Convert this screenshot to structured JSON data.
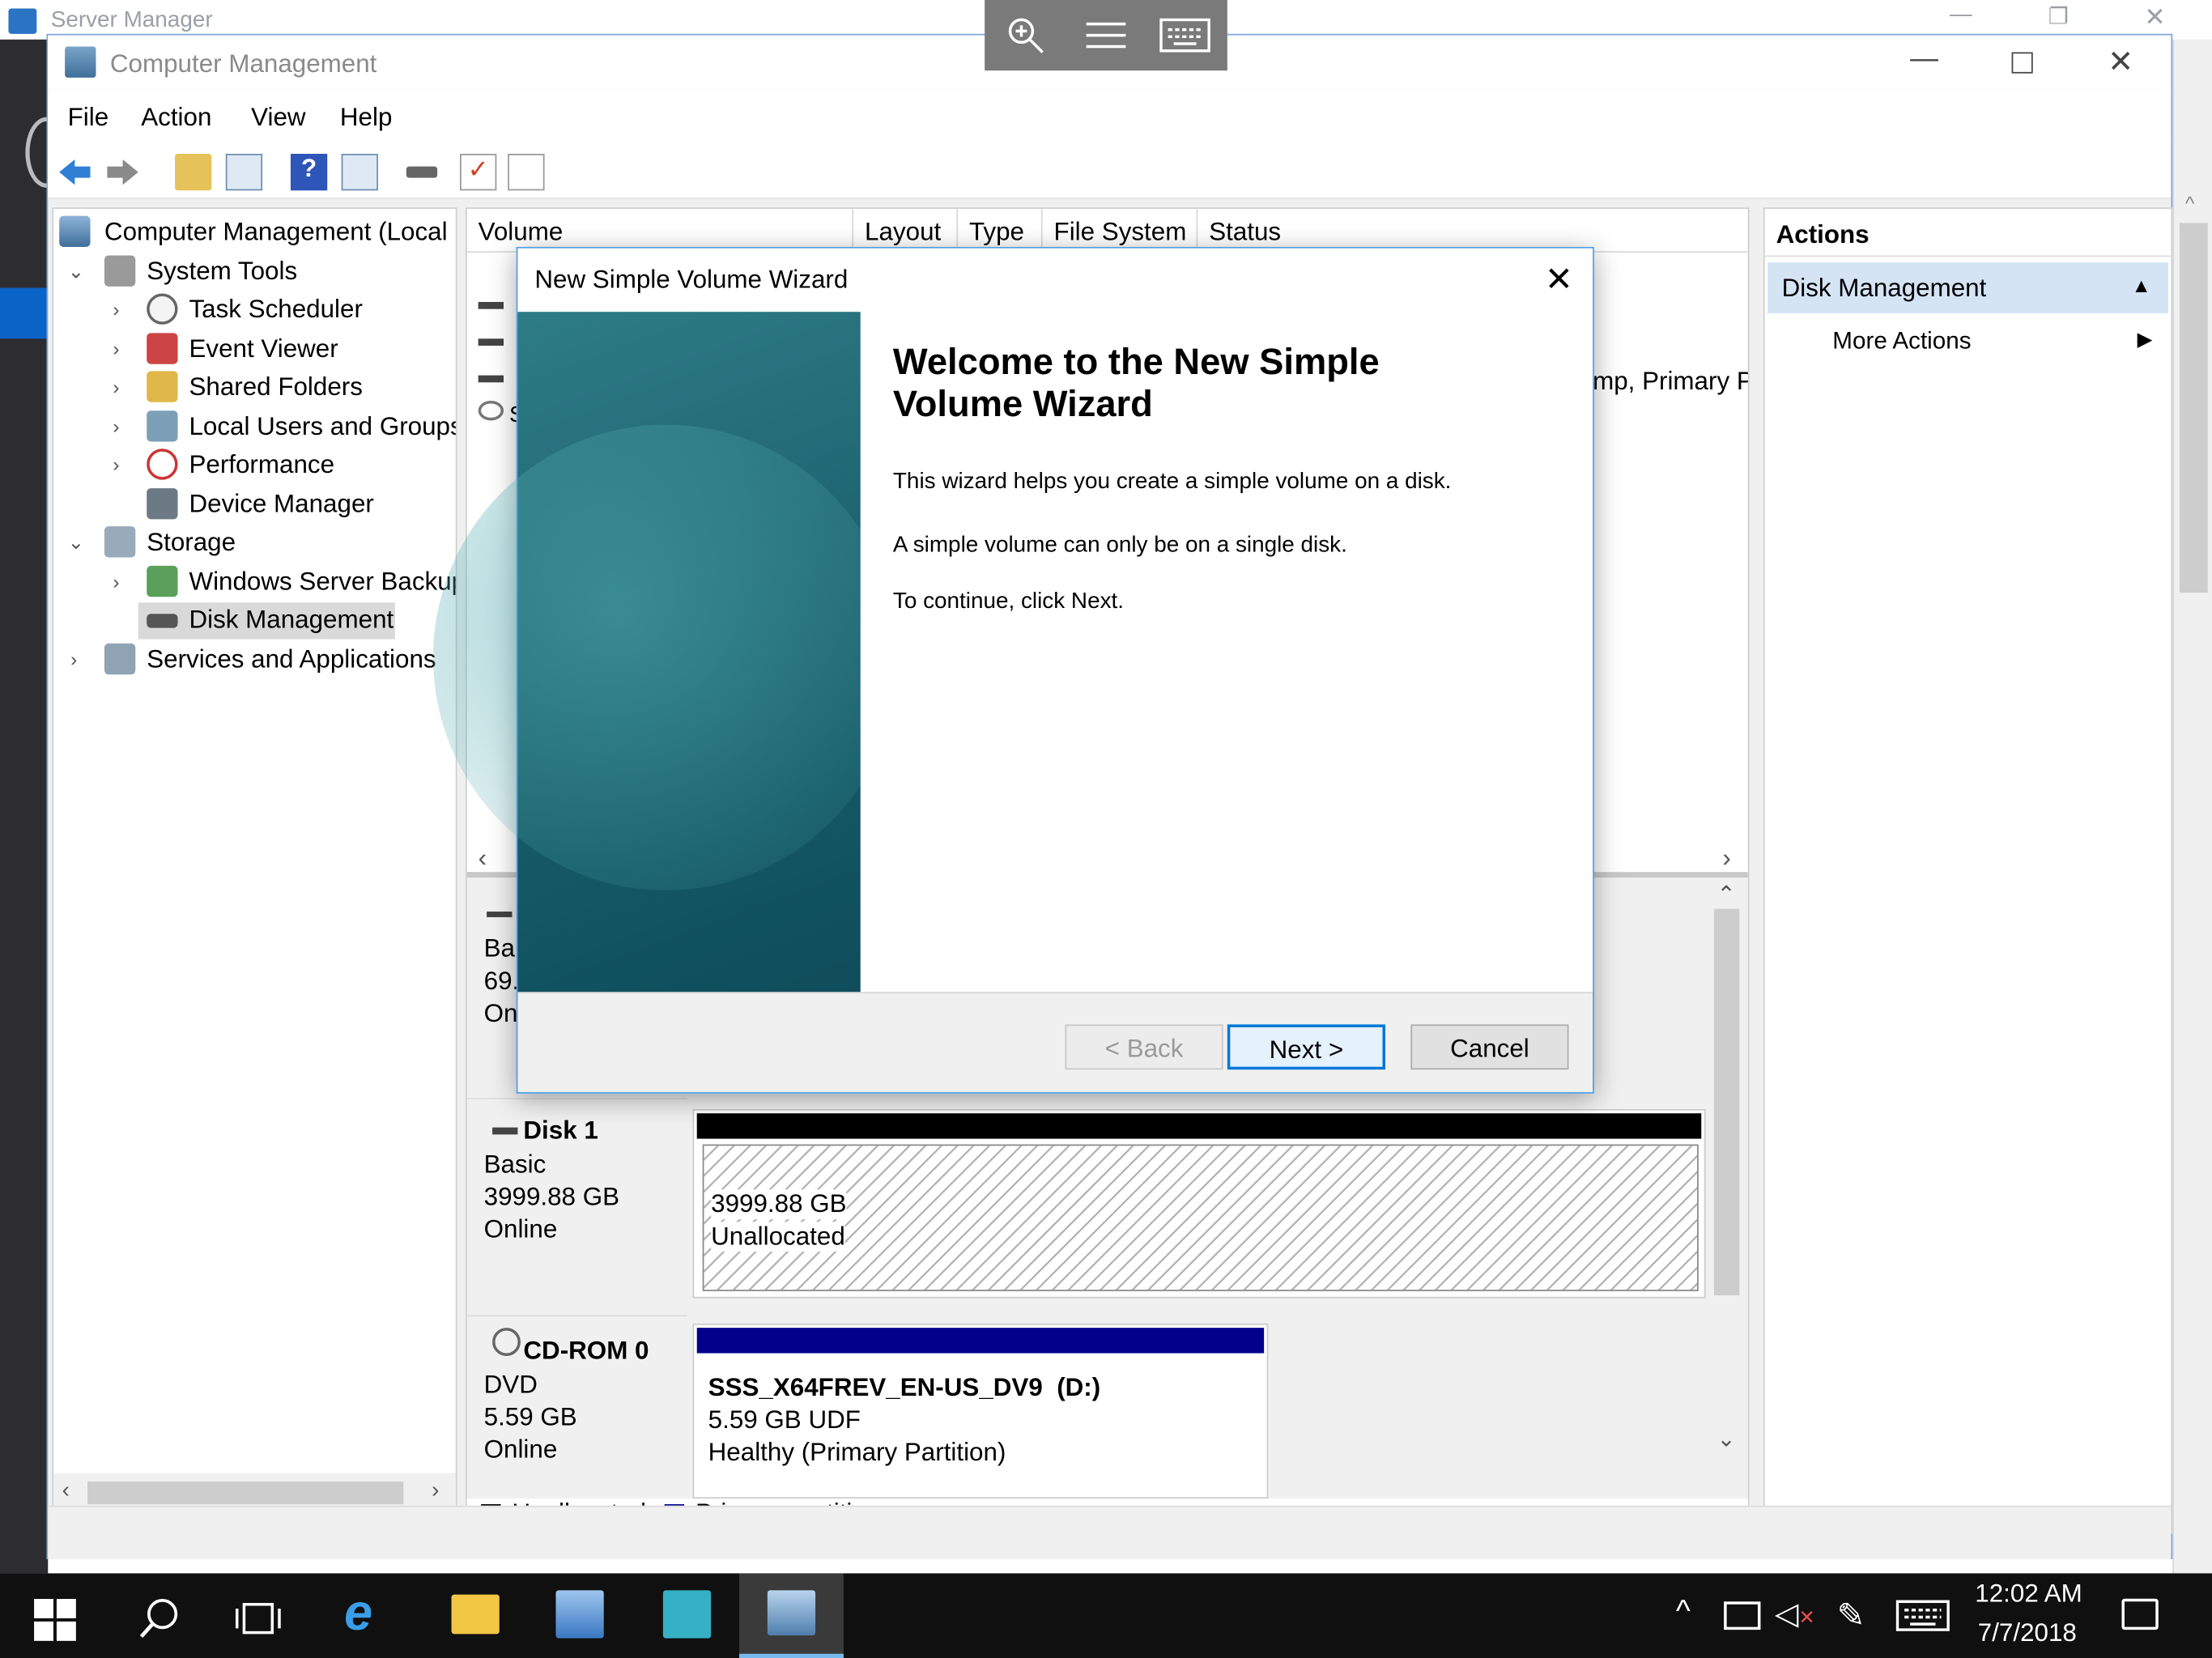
{
  "background_window": {
    "title": "Server Manager"
  },
  "window": {
    "title": "Computer Management"
  },
  "menu": [
    "File",
    "Action",
    "View",
    "Help"
  ],
  "tree": {
    "root": "Computer Management (Local",
    "system_tools": "System Tools",
    "task_scheduler": "Task Scheduler",
    "event_viewer": "Event Viewer",
    "shared_folders": "Shared Folders",
    "local_users": "Local Users and Groups",
    "performance": "Performance",
    "device_manager": "Device Manager",
    "storage": "Storage",
    "wsb": "Windows Server Backup",
    "disk_management": "Disk Management",
    "services": "Services and Applications"
  },
  "volume_list": {
    "columns": [
      "Volume",
      "Layout",
      "Type",
      "File System",
      "Status"
    ],
    "partial_text": "mp, Primary P",
    "partial_s": "S"
  },
  "disk0_partial": {
    "line1": "Ba",
    "line2": "69.",
    "line3": "On"
  },
  "disk1": {
    "name": "Disk 1",
    "type": "Basic",
    "size": "3999.88 GB",
    "status": "Online",
    "part_size": "3999.88 GB",
    "part_label": "Unallocated"
  },
  "cdrom": {
    "name": "CD-ROM 0",
    "type": "DVD",
    "size": "5.59 GB",
    "status": "Online",
    "vol_name": "SSS_X64FREV_EN-US_DV9  (D:)",
    "vol_fs": "5.59 GB UDF",
    "vol_status": "Healthy (Primary Partition)"
  },
  "legend": {
    "unallocated": "Unallocated",
    "primary": "Primary partition"
  },
  "actions": {
    "header": "Actions",
    "section": "Disk Management",
    "more": "More Actions"
  },
  "dialog": {
    "title": "New Simple Volume Wizard",
    "heading_line1": "Welcome to the New Simple",
    "heading_line2": "Volume Wizard",
    "p1": "This wizard helps you create a simple volume on a disk.",
    "p2": "A simple volume can only be on a single disk.",
    "p3": "To continue, click Next.",
    "back": "< Back",
    "next": "Next >",
    "cancel": "Cancel"
  },
  "clock": {
    "time": "12:02 AM",
    "date": "7/7/2018"
  },
  "colors": {
    "accent": "#0078d7",
    "primary_partition": "#00008b",
    "unallocated": "#000000",
    "selection": "#cce8ff"
  }
}
